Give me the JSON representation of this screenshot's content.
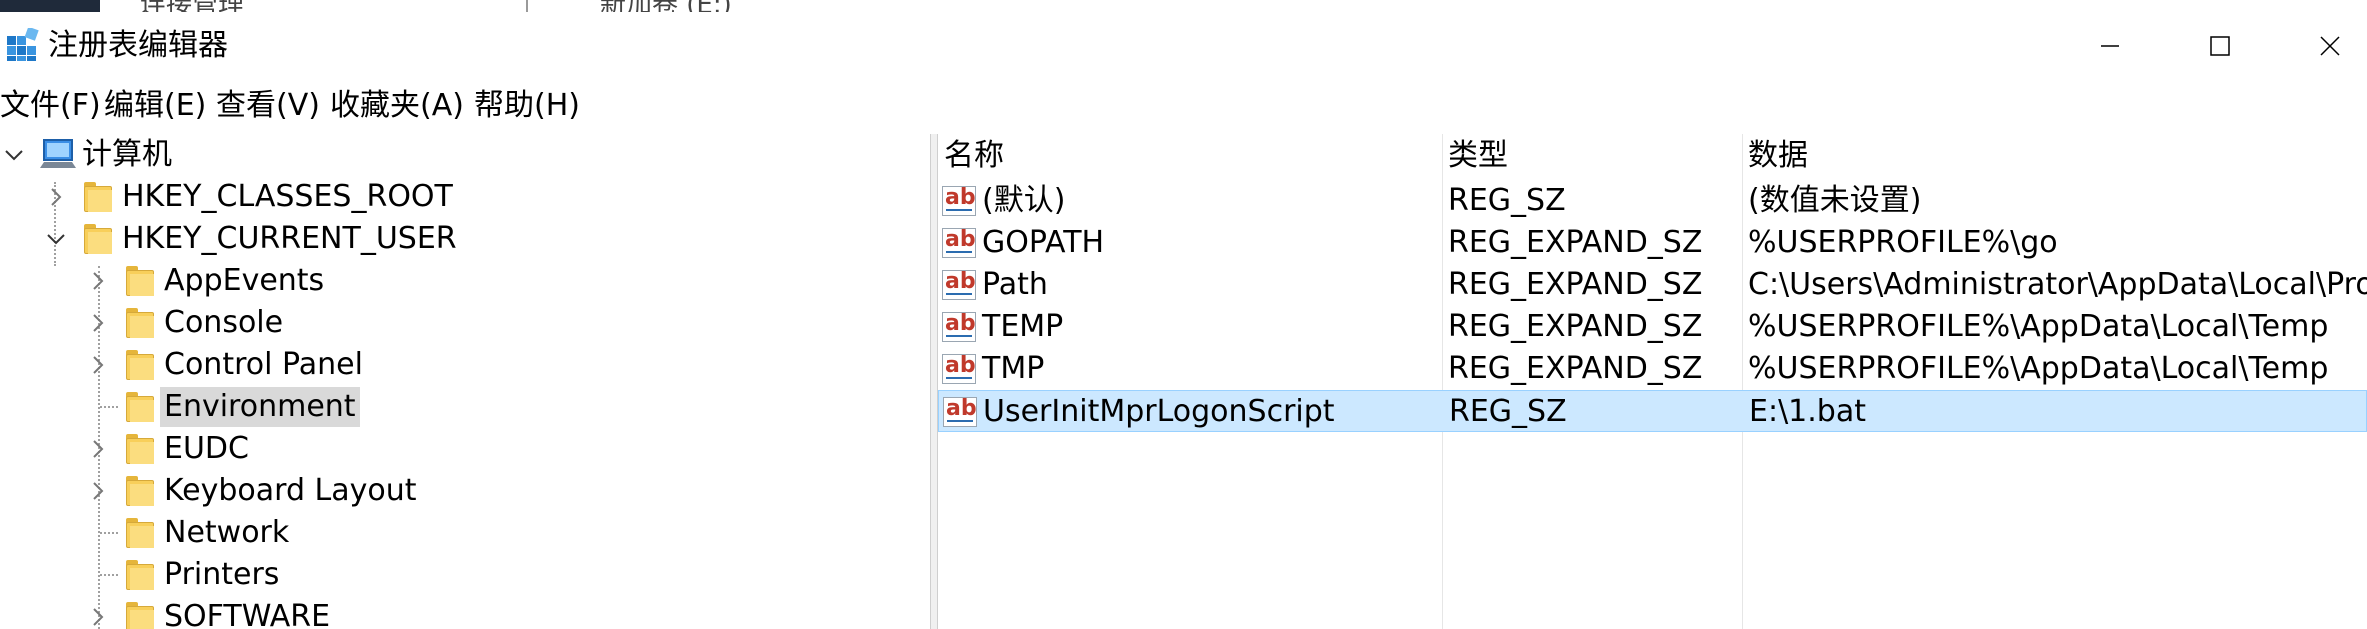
{
  "background_window": {
    "tab1": "连接管理",
    "tab2": "新加卷 (E:)"
  },
  "window": {
    "title": "注册表编辑器",
    "minimize_glyph": "—",
    "maximize_glyph": "☐",
    "close_glyph": "✕"
  },
  "menu": {
    "file": "文件(F)",
    "edit": "编辑(E)",
    "view": "查看(V)",
    "favorites": "收藏夹(A)",
    "help": "帮助(H)"
  },
  "tree": {
    "root": "计算机",
    "hkcr": "HKEY_CLASSES_ROOT",
    "hkcu": "HKEY_CURRENT_USER",
    "children": [
      {
        "label": "AppEvents",
        "expandable": true
      },
      {
        "label": "Console",
        "expandable": true
      },
      {
        "label": "Control Panel",
        "expandable": true
      },
      {
        "label": "Environment",
        "expandable": false,
        "selected": true
      },
      {
        "label": "EUDC",
        "expandable": true
      },
      {
        "label": "Keyboard Layout",
        "expandable": true
      },
      {
        "label": "Network",
        "expandable": false
      },
      {
        "label": "Printers",
        "expandable": false
      },
      {
        "label": "SOFTWARE",
        "expandable": true
      }
    ]
  },
  "list": {
    "headers": {
      "name": "名称",
      "type": "类型",
      "data": "数据"
    },
    "rows": [
      {
        "name": "(默认)",
        "type": "REG_SZ",
        "data": "(数值未设置)"
      },
      {
        "name": "GOPATH",
        "type": "REG_EXPAND_SZ",
        "data": "%USERPROFILE%\\go"
      },
      {
        "name": "Path",
        "type": "REG_EXPAND_SZ",
        "data": "C:\\Users\\Administrator\\AppData\\Local\\Prog"
      },
      {
        "name": "TEMP",
        "type": "REG_EXPAND_SZ",
        "data": "%USERPROFILE%\\AppData\\Local\\Temp"
      },
      {
        "name": "TMP",
        "type": "REG_EXPAND_SZ",
        "data": "%USERPROFILE%\\AppData\\Local\\Temp"
      },
      {
        "name": "UserInitMprLogonScript",
        "type": "REG_SZ",
        "data": "E:\\1.bat",
        "selected": true
      }
    ],
    "icon_text": "ab"
  },
  "colors": {
    "selection": "#cce8ff",
    "tree_selection": "#d9d9d9",
    "folder": "#f8cf5a"
  }
}
